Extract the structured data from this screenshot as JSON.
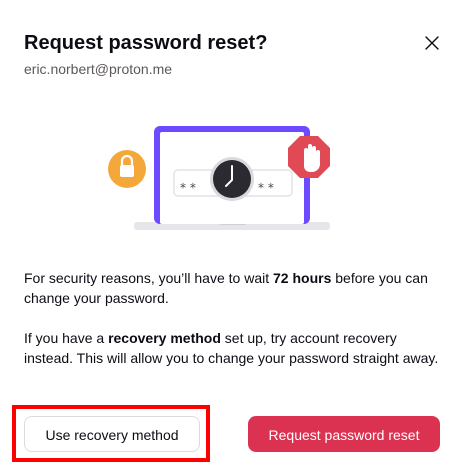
{
  "dialog": {
    "title": "Request password reset?",
    "email": "eric.norbert@proton.me"
  },
  "illustration": {
    "password_mask_left": "⁎ ⁎",
    "password_mask_right": "⁎ ⁎"
  },
  "body": {
    "para1_before": "For security reasons, you’ll have to wait ",
    "para1_bold": "72 hours",
    "para1_after": " before you can change your password.",
    "para2_before": "If you have a ",
    "para2_bold": "recovery method",
    "para2_after": " set up, try account recovery instead. This will allow you to change your password straight away."
  },
  "buttons": {
    "secondary_label": "Use recovery method",
    "primary_label": "Request password reset"
  },
  "colors": {
    "primary": "#dc3251",
    "lock_badge": "#f5a83a",
    "stop_badge": "#e04a55",
    "laptop": "#6d4aff"
  }
}
